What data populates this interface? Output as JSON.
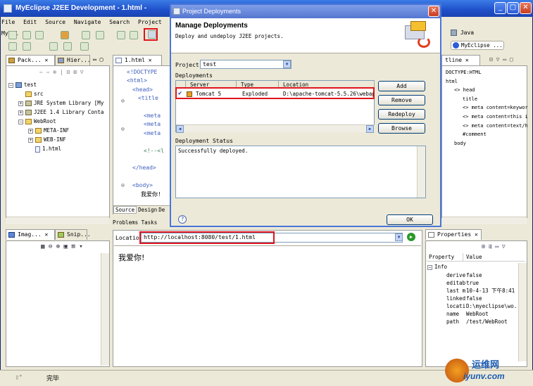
{
  "window": {
    "title": "MyEclipse J2EE Development - 1.html -"
  },
  "menu": [
    "File",
    "Edit",
    "Source",
    "Navigate",
    "Search",
    "Project",
    "MyEcl"
  ],
  "perspectives": {
    "java": "Java",
    "myeclipse": "MyEclipse ..."
  },
  "package_explorer": {
    "tabs": [
      "Pack...",
      "Hier..."
    ],
    "tree": [
      {
        "label": "test",
        "kind": "project",
        "depth": 0,
        "exp": "−"
      },
      {
        "label": "src",
        "kind": "folder",
        "depth": 1,
        "exp": ""
      },
      {
        "label": "JRE System Library [My",
        "kind": "jar",
        "depth": 1,
        "exp": "+"
      },
      {
        "label": "J2EE 1.4 Library Conta",
        "kind": "jar",
        "depth": 1,
        "exp": "+"
      },
      {
        "label": "WebRoot",
        "kind": "folder",
        "depth": 1,
        "exp": "−"
      },
      {
        "label": "META-INF",
        "kind": "folder",
        "depth": 2,
        "exp": "+"
      },
      {
        "label": "WEB-INF",
        "kind": "folder",
        "depth": 2,
        "exp": "+"
      },
      {
        "label": "1.html",
        "kind": "file",
        "depth": 2,
        "exp": ""
      }
    ]
  },
  "editor": {
    "tab": "1.html",
    "lines": [
      "<!DOCTYPE",
      "<html>",
      "<head>",
      "<title",
      "",
      "<meta",
      "<meta",
      "<meta",
      "",
      "<!--<l",
      "",
      "</head>",
      "",
      "<body>",
      "我爱你!"
    ],
    "bottom_tabs": [
      "Source",
      "Design",
      "De"
    ]
  },
  "outline": {
    "tab": "tline",
    "items": [
      {
        "label": "DOCTYPE:HTML",
        "depth": 0
      },
      {
        "label": "html",
        "depth": 0
      },
      {
        "label": "<> head",
        "depth": 1
      },
      {
        "label": "title",
        "depth": 2
      },
      {
        "label": "<> meta content=keywor",
        "depth": 2
      },
      {
        "label": "<> meta content=this i",
        "depth": 2
      },
      {
        "label": "<> meta content=text/h",
        "depth": 2
      },
      {
        "label": "#comment",
        "depth": 2
      },
      {
        "label": "body",
        "depth": 1
      }
    ]
  },
  "dialog": {
    "title": "Project Deployments",
    "heading": "Manage Deployments",
    "subheading": "Deploy and undeploy J2EE projects.",
    "project_label": "Project",
    "project_value": "test",
    "deployments_label": "Deployments",
    "columns": [
      "Server",
      "Type",
      "Location"
    ],
    "rows": [
      {
        "check": "✔",
        "server": "Tomcat 5",
        "type": "Exploded",
        "location": "D:\\apache-tomcat-5.5.26\\webap"
      }
    ],
    "buttons": {
      "add": "Add",
      "remove": "Remove",
      "redeploy": "Redeploy",
      "browse": "Browse"
    },
    "status_label": "Deployment Status",
    "status_text": "Successfully deployed.",
    "help": "?",
    "ok": "OK"
  },
  "bottom_tabs": [
    "Problems",
    "Tasks"
  ],
  "image_panel": {
    "tabs": [
      "Imag...",
      "Snip..."
    ]
  },
  "browser": {
    "location_label": "Location",
    "url": "http://localhost:8080/test/1.html",
    "content": "我爱你!"
  },
  "properties": {
    "tab": "Properties",
    "columns": [
      "Property",
      "Value"
    ],
    "group": "Info",
    "rows": [
      {
        "key": "derive",
        "value": "false"
      },
      {
        "key": "editab",
        "value": "true"
      },
      {
        "key": "last m",
        "value": "10-4-13 下午8:41"
      },
      {
        "key": "linked",
        "value": "false"
      },
      {
        "key": "locati",
        "value": "D:\\myeclipse\\wo..."
      },
      {
        "key": "name",
        "value": "WebRoot"
      },
      {
        "key": "path",
        "value": "/test/WebRoot"
      }
    ]
  },
  "status": {
    "text": "完毕"
  },
  "watermark": {
    "cn": "运维网",
    "en": "iyunv.com"
  },
  "colors": {
    "highlight": "#e0141c",
    "title_blue": "#2456c8"
  }
}
